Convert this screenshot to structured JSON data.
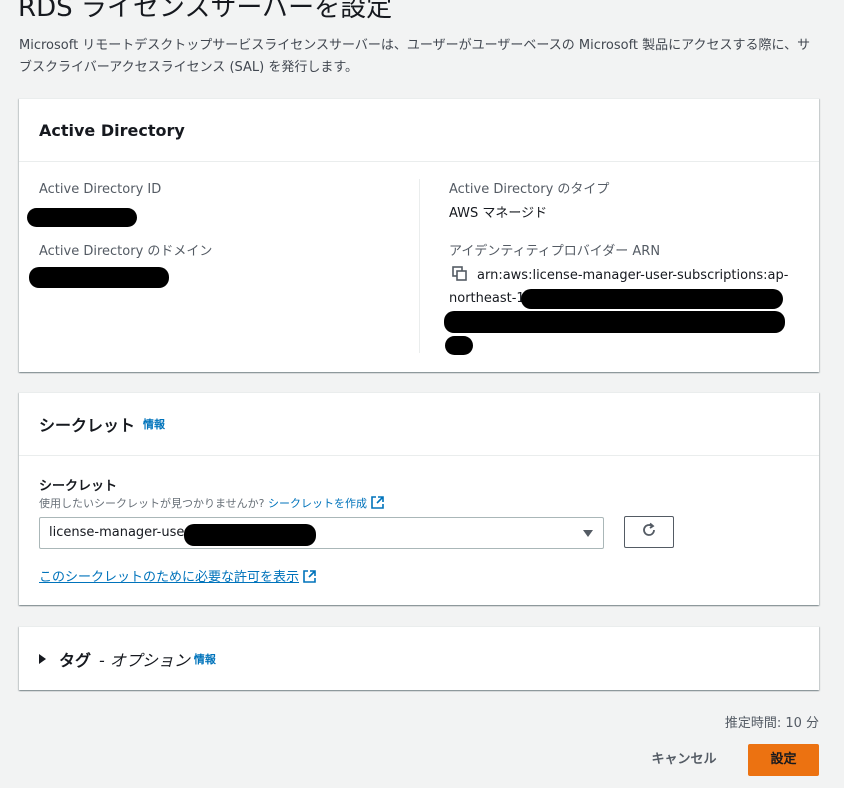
{
  "page": {
    "title": "RDS ライセンスサーバーを設定",
    "description": "Microsoft リモートデスクトップサービスライセンスサーバーは、ユーザーがユーザーベースの Microsoft 製品にアクセスする際に、サブスクライバーアクセスライセンス (SAL) を発行します。"
  },
  "active_directory": {
    "heading": "Active Directory",
    "id_label": "Active Directory ID",
    "domain_label": "Active Directory のドメイン",
    "type_label": "Active Directory のタイプ",
    "type_value": "AWS マネージド",
    "arn_label": "アイデンティティプロバイダー ARN",
    "arn_line1": "arn:aws:license-manager-user-subscriptions:ap-",
    "arn_line2": "northeast-1"
  },
  "secret": {
    "heading": "シークレット",
    "info": "情報",
    "field_label": "シークレット",
    "help_text": "使用したいシークレットが見つかりませんか?",
    "create_link": "シークレットを作成",
    "selected_value": "license-manager-user",
    "permissions_link": "このシークレットのために必要な許可を表示"
  },
  "tags": {
    "heading": "タグ",
    "optional": "- オプション",
    "info": "情報"
  },
  "footer": {
    "estimated_time": "推定時間: 10 分",
    "cancel_label": "キャンセル",
    "submit_label": "設定"
  },
  "colors": {
    "primary_button": "#ec7211",
    "link": "#0073bb",
    "background": "#f2f3f3"
  }
}
